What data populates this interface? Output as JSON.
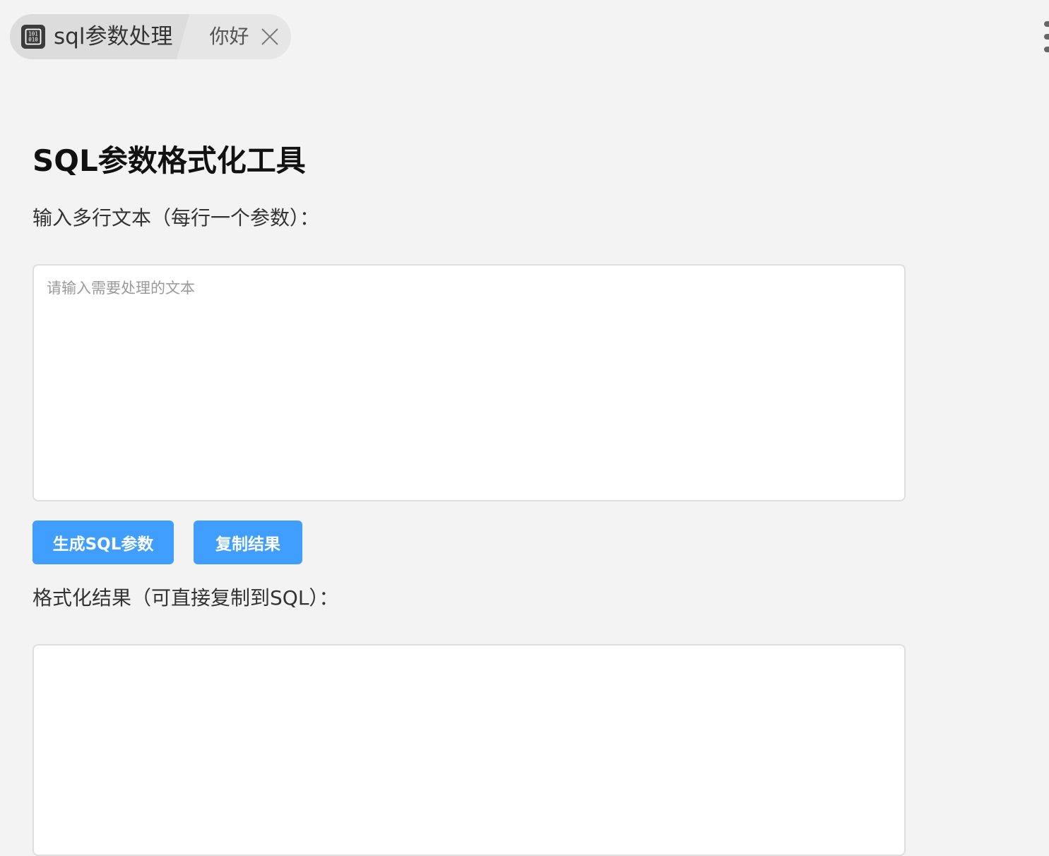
{
  "tabs": {
    "active": {
      "icon": "binary-code-icon",
      "title": "sql参数处理"
    },
    "second": {
      "label": "你好",
      "close_icon": "close-icon"
    },
    "more_icon": "more-vertical-icon"
  },
  "main": {
    "title": "SQL参数格式化工具",
    "input_label": "输入多行文本（每行一个参数）：",
    "input": {
      "placeholder": "请输入需要处理的文本",
      "value": ""
    },
    "buttons": {
      "generate_label": "生成SQL参数",
      "copy_label": "复制结果"
    },
    "output_label": "格式化结果（可直接复制到SQL）：",
    "output": {
      "value": ""
    }
  },
  "colors": {
    "accent": "#409eff",
    "background": "#f3f3f3"
  }
}
